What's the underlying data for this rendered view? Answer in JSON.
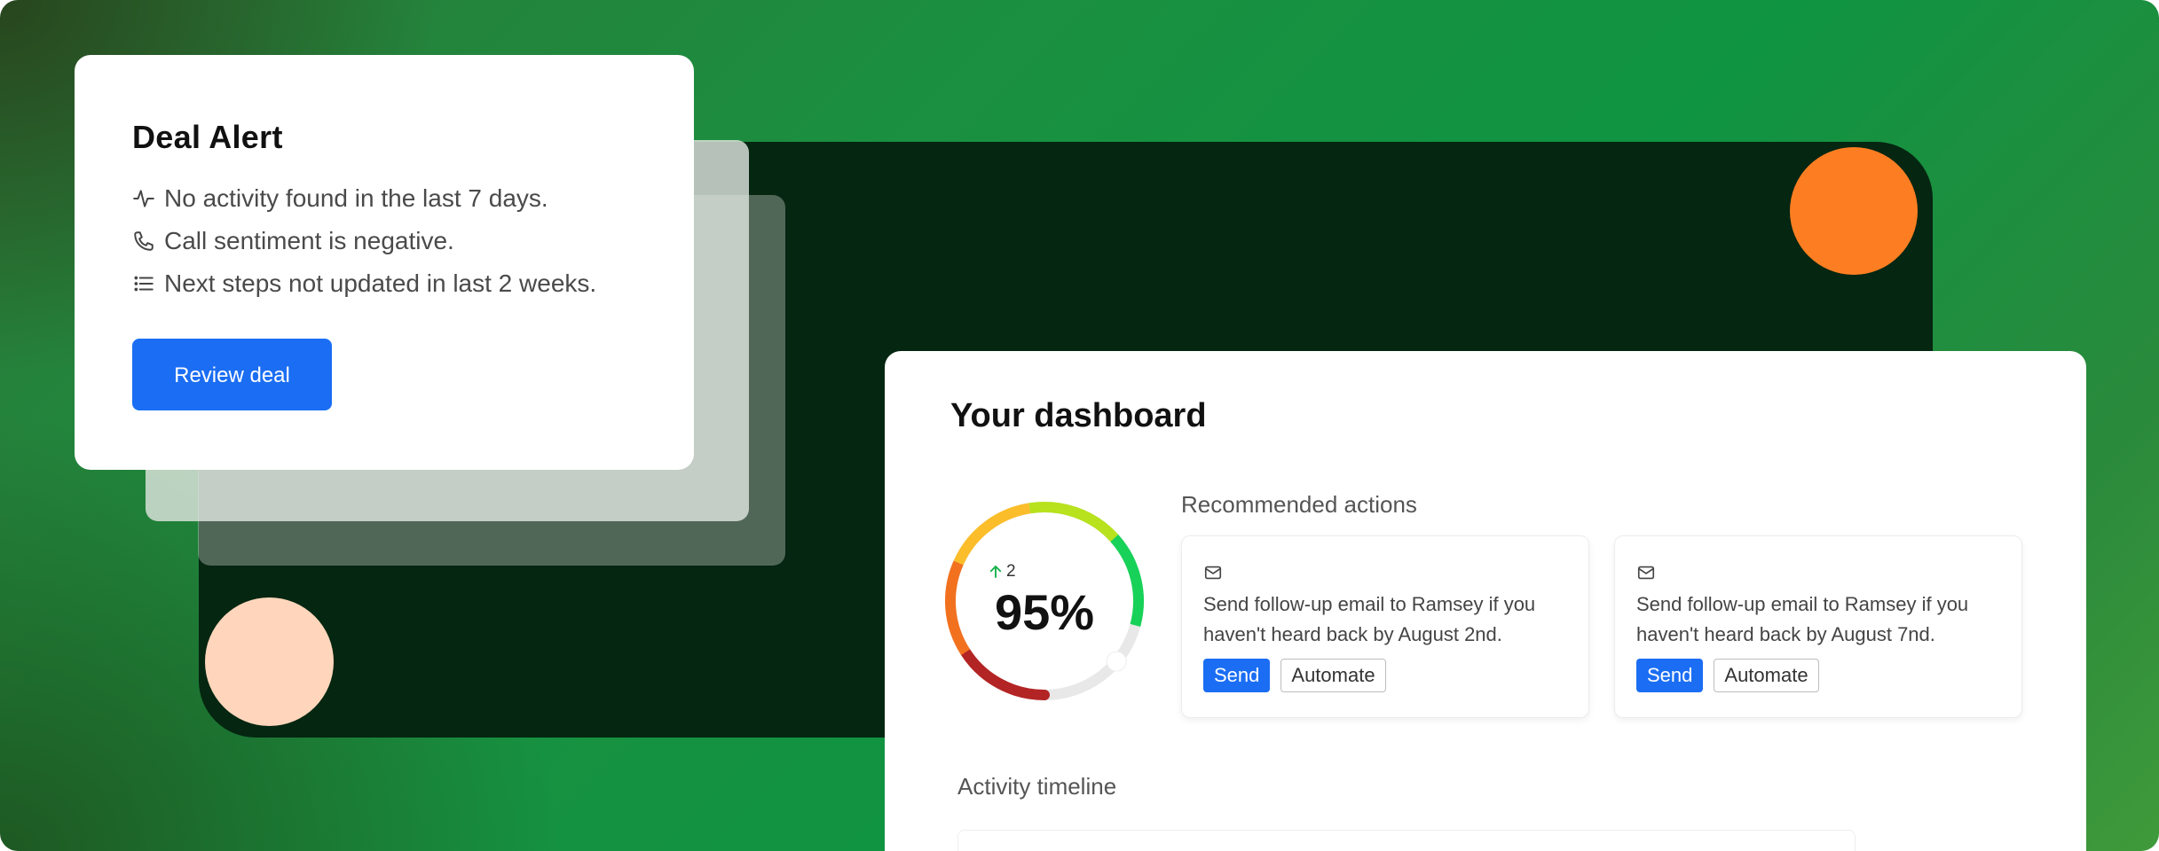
{
  "deal_alert": {
    "title": "Deal Alert",
    "items": [
      {
        "icon": "activity-icon",
        "text": "No activity found in the last 7 days."
      },
      {
        "icon": "phone-icon",
        "text": "Call sentiment is negative."
      },
      {
        "icon": "list-icon",
        "text": "Next steps not updated in last 2 weeks."
      }
    ],
    "button_label": "Review deal"
  },
  "dashboard": {
    "title": "Your dashboard",
    "score": {
      "value": "95%",
      "delta": "2",
      "delta_icon": "arrow-up-icon",
      "percent": 95
    },
    "recommended_title": "Recommended actions",
    "actions": [
      {
        "icon": "mail-icon",
        "text": "Send follow-up email to Ramsey if you haven't heard back by August 2nd.",
        "primary_label": "Send",
        "secondary_label": "Automate"
      },
      {
        "icon": "mail-icon",
        "text": "Send follow-up email to Ramsey if you haven't heard back by August 7nd.",
        "primary_label": "Send",
        "secondary_label": "Automate"
      }
    ],
    "timeline_title": "Activity timeline"
  },
  "colors": {
    "accent_blue": "#1b6ef3",
    "brand_green": "#0f9442",
    "dark_green": "#052611",
    "orange": "#fd7e22",
    "peach": "#ffd6bb"
  }
}
